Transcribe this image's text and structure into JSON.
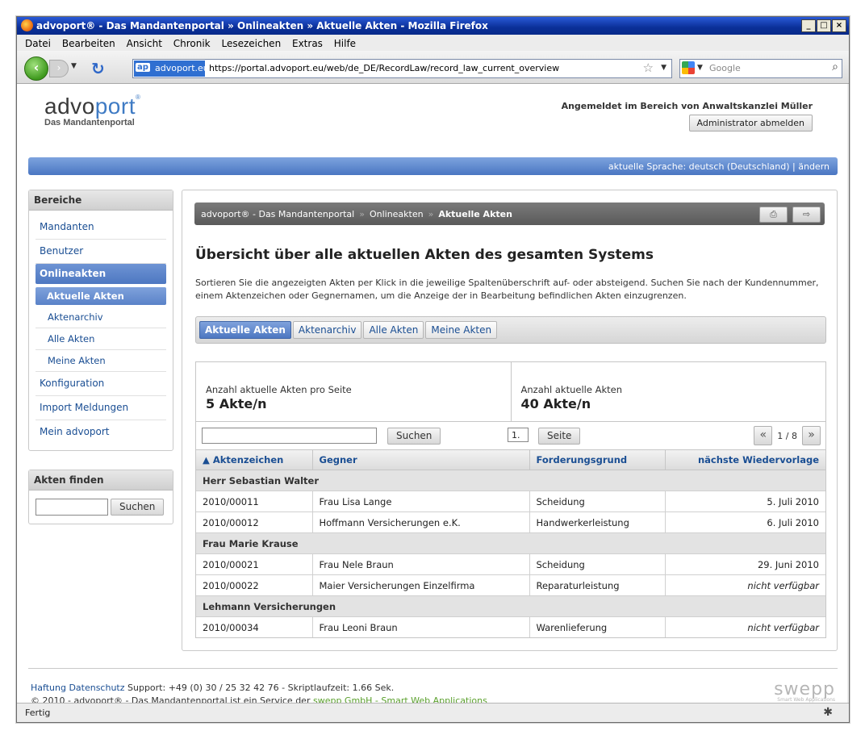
{
  "window": {
    "title": "advoport® - Das Mandantenportal » Onlineakten » Aktuelle Akten - Mozilla Firefox"
  },
  "menu": [
    "Datei",
    "Bearbeiten",
    "Ansicht",
    "Chronik",
    "Lesezeichen",
    "Extras",
    "Hilfe"
  ],
  "urlbar": {
    "site": "advoport.eu",
    "url": "https://portal.advoport.eu/web/de_DE/RecordLaw/record_law_current_overview",
    "search_placeholder": "Google"
  },
  "header": {
    "logo_left": "advo",
    "logo_right": "port",
    "logo_sub": "Das Mandantenportal",
    "logged_in": "Angemeldet im Bereich von Anwaltskanzlei Müller",
    "logout": "Administrator abmelden",
    "language": "aktuelle Sprache: deutsch (Deutschland) | ändern"
  },
  "sidebar": {
    "areas_title": "Bereiche",
    "items": [
      {
        "label": "Mandanten"
      },
      {
        "label": "Benutzer"
      },
      {
        "label": "Onlineakten"
      },
      {
        "label": "Aktuelle Akten"
      },
      {
        "label": "Aktenarchiv"
      },
      {
        "label": "Alle Akten"
      },
      {
        "label": "Meine Akten"
      },
      {
        "label": "Konfiguration"
      },
      {
        "label": "Import Meldungen"
      },
      {
        "label": "Mein advoport"
      }
    ],
    "find_title": "Akten finden",
    "find_button": "Suchen"
  },
  "breadcrumb": {
    "home": "advoport® - Das Mandantenportal",
    "section": "Onlineakten",
    "current": "Aktuelle Akten"
  },
  "main": {
    "title": "Übersicht über alle aktuellen Akten des gesamten Systems",
    "description": "Sortieren Sie die angezeigten Akten per Klick in die jeweilige Spaltenüberschrift auf- oder absteigend. Suchen Sie nach der Kundennummer, einem Aktenzeichen oder Gegnernamen, um die Anzeige der in Bearbeitung befindlichen Akten einzugrenzen.",
    "tabs": [
      "Aktuelle Akten",
      "Aktenarchiv",
      "Alle Akten",
      "Meine Akten"
    ],
    "stats": {
      "per_page_label": "Anzahl aktuelle Akten pro Seite",
      "per_page_value": "5 Akte/n",
      "total_label": "Anzahl aktuelle Akten",
      "total_value": "40 Akte/n"
    },
    "search_button": "Suchen",
    "page_value": "1.",
    "page_button": "Seite",
    "pager_count": "1 / 8",
    "columns": [
      "▲ Aktenzeichen",
      "Gegner",
      "Forderungsgrund",
      "nächste Wiedervorlage"
    ],
    "groups": [
      {
        "name": "Herr Sebastian Walter",
        "rows": [
          {
            "az": "2010/00011",
            "gegner": "Frau Lisa Lange",
            "grund": "Scheidung",
            "wv": "5. Juli 2010"
          },
          {
            "az": "2010/00012",
            "gegner": "Hoffmann Versicherungen e.K.",
            "grund": "Handwerkerleistung",
            "wv": "6. Juli 2010"
          }
        ]
      },
      {
        "name": "Frau Marie Krause",
        "rows": [
          {
            "az": "2010/00021",
            "gegner": "Frau Nele Braun",
            "grund": "Scheidung",
            "wv": "29. Juni 2010"
          },
          {
            "az": "2010/00022",
            "gegner": "Maier Versicherungen Einzelfirma",
            "grund": "Reparaturleistung",
            "wv": "nicht verfügbar"
          }
        ]
      },
      {
        "name": "Lehmann Versicherungen",
        "rows": [
          {
            "az": "2010/00034",
            "gegner": "Frau Leoni Braun",
            "grund": "Warenlieferung",
            "wv": "nicht verfügbar"
          }
        ]
      }
    ]
  },
  "footer": {
    "link1": "Haftung",
    "link2": "Datenschutz",
    "support": "Support: +49 (0) 30 / 25 32 42 76 - Skriptlaufzeit: 1.66 Sek.",
    "copyright": "© 2010 - advoport® - Das Mandantenportal ist ein Service der",
    "company": "swepp GmbH - Smart Web Applications",
    "brand": "swepp",
    "brand_tag": "Smart Web Applications"
  },
  "status": "Fertig",
  "colors": {
    "accent": "#4d77c1",
    "link": "#1a4e93",
    "green": "#5aa02c"
  }
}
